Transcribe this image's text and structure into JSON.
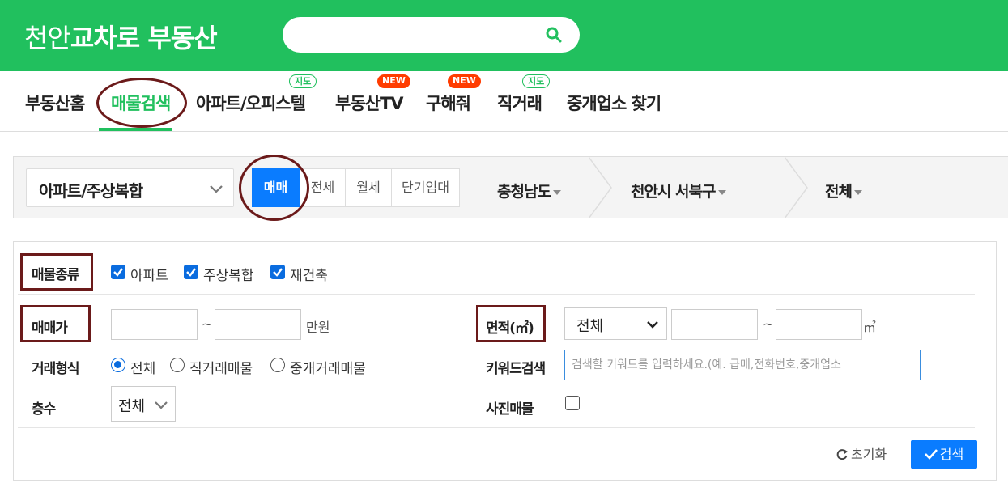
{
  "header": {
    "logo_part1": "천안",
    "logo_part2": "교차로 부동산",
    "search_placeholder": "",
    "brand_color": "#21c05e"
  },
  "gnb": {
    "items": [
      {
        "label": "부동산홈"
      },
      {
        "label": "매물검색"
      },
      {
        "label": "아파트/오피스텔",
        "badge": "지도"
      },
      {
        "label": "부동산TV",
        "badge": "NEW"
      },
      {
        "label": "구해줘",
        "badge": "NEW"
      },
      {
        "label": "직거래",
        "badge": "지도"
      },
      {
        "label": "중개업소 찾기"
      }
    ],
    "active_index": 1
  },
  "filterbar": {
    "property_type": "아파트/주상복합",
    "deal_types": [
      "매매",
      "전세",
      "월세",
      "단기임대"
    ],
    "deal_selected": "매매",
    "region": {
      "province": "충청남도",
      "city": "천안시 서북구",
      "district": "전체"
    }
  },
  "panel": {
    "property_kind": {
      "label": "매물종류",
      "options": [
        {
          "label": "아파트",
          "checked": true
        },
        {
          "label": "주상복합",
          "checked": true
        },
        {
          "label": "재건축",
          "checked": true
        }
      ]
    },
    "price": {
      "label": "매매가",
      "min": "",
      "max": "",
      "tilde": "~",
      "unit": "만원"
    },
    "area": {
      "label": "면적(㎡)",
      "select_value": "전체",
      "min": "",
      "max": "",
      "tilde": "~",
      "unit": "㎡"
    },
    "trade_form": {
      "label": "거래형식",
      "options": [
        {
          "label": "전체",
          "selected": true
        },
        {
          "label": "직거래매물",
          "selected": false
        },
        {
          "label": "중개거래매물",
          "selected": false
        }
      ]
    },
    "keyword": {
      "label": "키워드검색",
      "placeholder": "검색할 키워드를 입력하세요.(예. 급매,전화번호,중개업소"
    },
    "floor": {
      "label": "층수",
      "select_value": "전체"
    },
    "photo": {
      "label": "사진매물",
      "checked": false
    },
    "reset_label": "초기화",
    "search_label": "검색"
  },
  "colors": {
    "accent_blue": "#0a7cff",
    "annotation_red": "#6b1a1a"
  }
}
